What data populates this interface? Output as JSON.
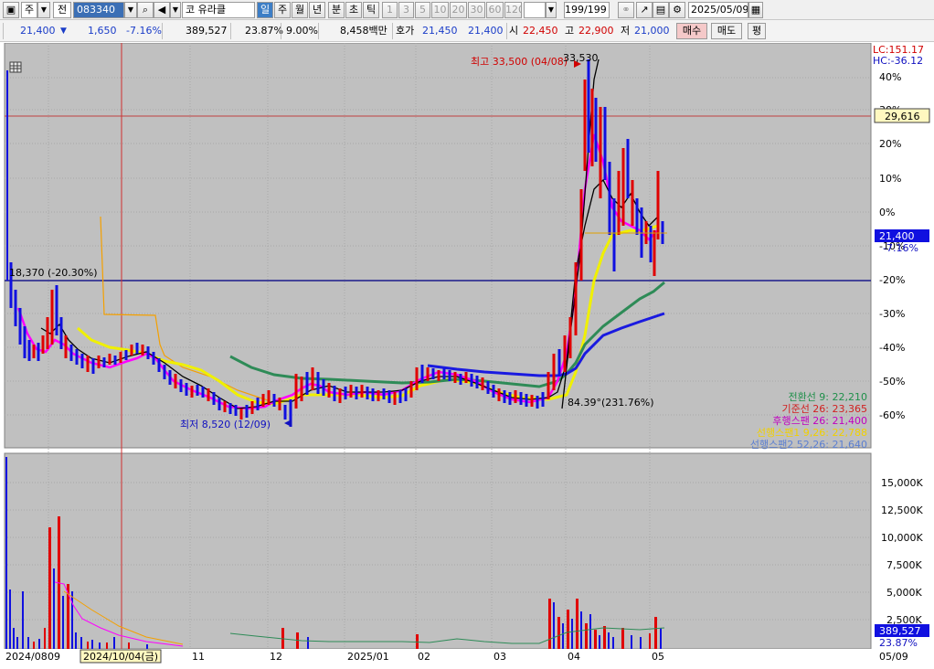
{
  "toolbar": {
    "market": "주",
    "type": "전",
    "code": "083340",
    "name_prefix": "코",
    "name": "유라클",
    "periods": [
      "일",
      "주",
      "월",
      "년",
      "분",
      "초",
      "틱"
    ],
    "minute_steps": [
      "1",
      "3",
      "5",
      "10",
      "20",
      "30",
      "60",
      "120"
    ],
    "count": "199/199",
    "date": "2025/05/09"
  },
  "quote": {
    "price": "21,400",
    "change": "1,650",
    "change_pct": "-7.16%",
    "volume": "389,527",
    "turnover_pct": "23.87%",
    "ratio": "9.00%",
    "amount": "8,458백만",
    "ask_label": "호가",
    "ask": "21,450",
    "bid": "21,400",
    "open_label": "시",
    "open": "22,450",
    "high_label": "고",
    "high": "22,900",
    "low_label": "저",
    "low": "21,000",
    "buy": "매수",
    "sell": "매도",
    "eval": "평"
  },
  "chart": {
    "lc": "LC:151.17",
    "hc": "HC:-36.12",
    "price_marker": "29,616",
    "current_price": "21,400",
    "current_pct": "-7.16%",
    "y_ticks": [
      "40%",
      "30%",
      "20%",
      "10%",
      "0%",
      "-10%",
      "-20%",
      "-30%",
      "-40%",
      "-50%",
      "-60%"
    ],
    "high_note": "최고 33,500 (04/08)",
    "high_peak": "33,530",
    "low_note": "최저 8,520 (12/09)",
    "left_note": "18,370 (-20.30%)",
    "ratio_note": "84.39°(231.76%)",
    "ichimoku": [
      {
        "label": "전환선 9: 22,210",
        "color": "#1f8f4a"
      },
      {
        "label": "기준선 26: 23,365",
        "color": "#d11f1f"
      },
      {
        "label": "후행스팬 26: 21,400",
        "color": "#c000c0"
      },
      {
        "label": "선행스팬1 9,26: 22,788",
        "color": "#f0d000"
      },
      {
        "label": "선행스팬2 52,26: 21,640",
        "color": "#5b7fd1"
      }
    ],
    "vol_ticks": [
      "15,000K",
      "12,500K",
      "10,000K",
      "7,500K",
      "5,000K",
      "2,500K"
    ],
    "vol_value": "389,527",
    "vol_pct": "23.87%",
    "x_labels": [
      "2024/08",
      "09",
      "2024/10/04(금)",
      "11",
      "12",
      "2025/01",
      "02",
      "03",
      "04",
      "05",
      "05/09"
    ]
  },
  "colors": {
    "chart_bg": "#c0c0c0",
    "up": "#e00000",
    "down": "#1010e0",
    "accent": "#3b6fb5"
  }
}
